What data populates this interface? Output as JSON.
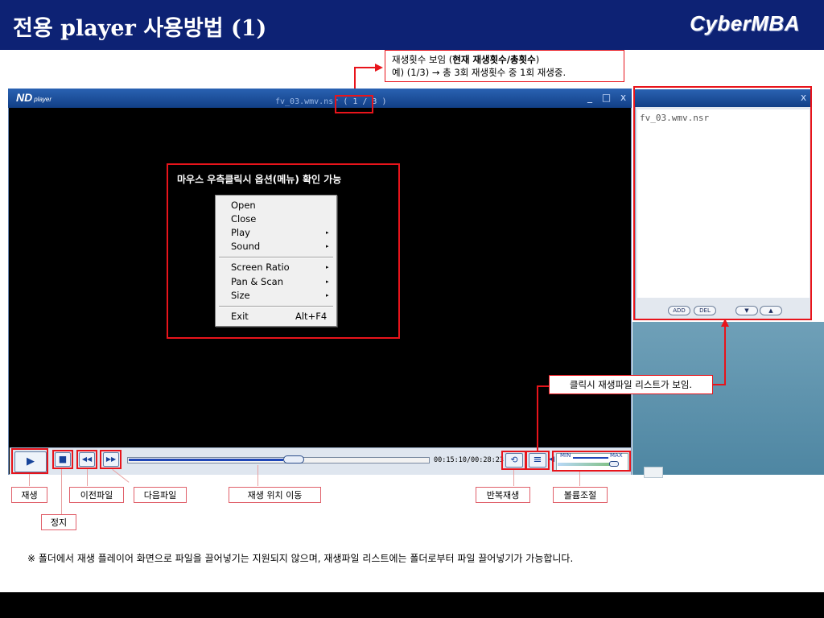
{
  "header": {
    "title": "전용 player 사용방법 (1)",
    "brand": "CyberMBA"
  },
  "player": {
    "logo": "ND",
    "logo_sub": "player",
    "filename": "fv_03.wmv.nsr",
    "play_count": "( 1 / 3 )",
    "window_controls": "_ □ x",
    "time": "00:15:10/00:28:23",
    "volume_min": "MIN",
    "volume_max": "MAX",
    "seek_position": 0.55,
    "volume_level": 0.9,
    "icons": {
      "play": "▶",
      "stop": "■",
      "prev": "◀◀",
      "next": "▶▶",
      "repeat": "⟲",
      "list": "≡",
      "volume": "◀"
    }
  },
  "context_menu": {
    "caption": "마우스 우측클릭시 옵션(메뉴) 확인 가능",
    "items": [
      {
        "label": "Open"
      },
      {
        "label": "Close"
      },
      {
        "label": "Play",
        "submenu": "▸"
      },
      {
        "label": "Sound",
        "submenu": "▸"
      },
      {
        "label": "Screen Ratio",
        "submenu": "▸"
      },
      {
        "label": "Pan & Scan",
        "submenu": "▸"
      },
      {
        "label": "Size",
        "submenu": "▸"
      },
      {
        "label": "Exit",
        "shortcut": "Alt+F4"
      }
    ]
  },
  "playlist": {
    "close": "x",
    "item": "fv_03.wmv.nsr",
    "add": "ADD",
    "del": "DEL",
    "down": "▼",
    "up": "▲",
    "callout": "클릭시 재생파일 리스트가 보임."
  },
  "callouts": {
    "count_line1_prefix": "재생횟수 보임 (",
    "count_line1_bold": "현재 재생횟수/총횟수",
    "count_line1_suffix": ")",
    "count_line2": "예) (1/3) → 총 3회 재생횟수 중 1회 재생중."
  },
  "labels": {
    "play": "재생",
    "stop": "정지",
    "prev": "이전파일",
    "next": "다음파일",
    "seek": "재생 위치 이동",
    "repeat": "반복재생",
    "volume": "볼륨조절"
  },
  "footnote": "※ 폴더에서 재생 플레이어 화면으로 파일을 끌어넣기는 지원되지 않으며, 재생파일 리스트에는 폴더로부터 파일 끌어넣기가 가능합니다."
}
